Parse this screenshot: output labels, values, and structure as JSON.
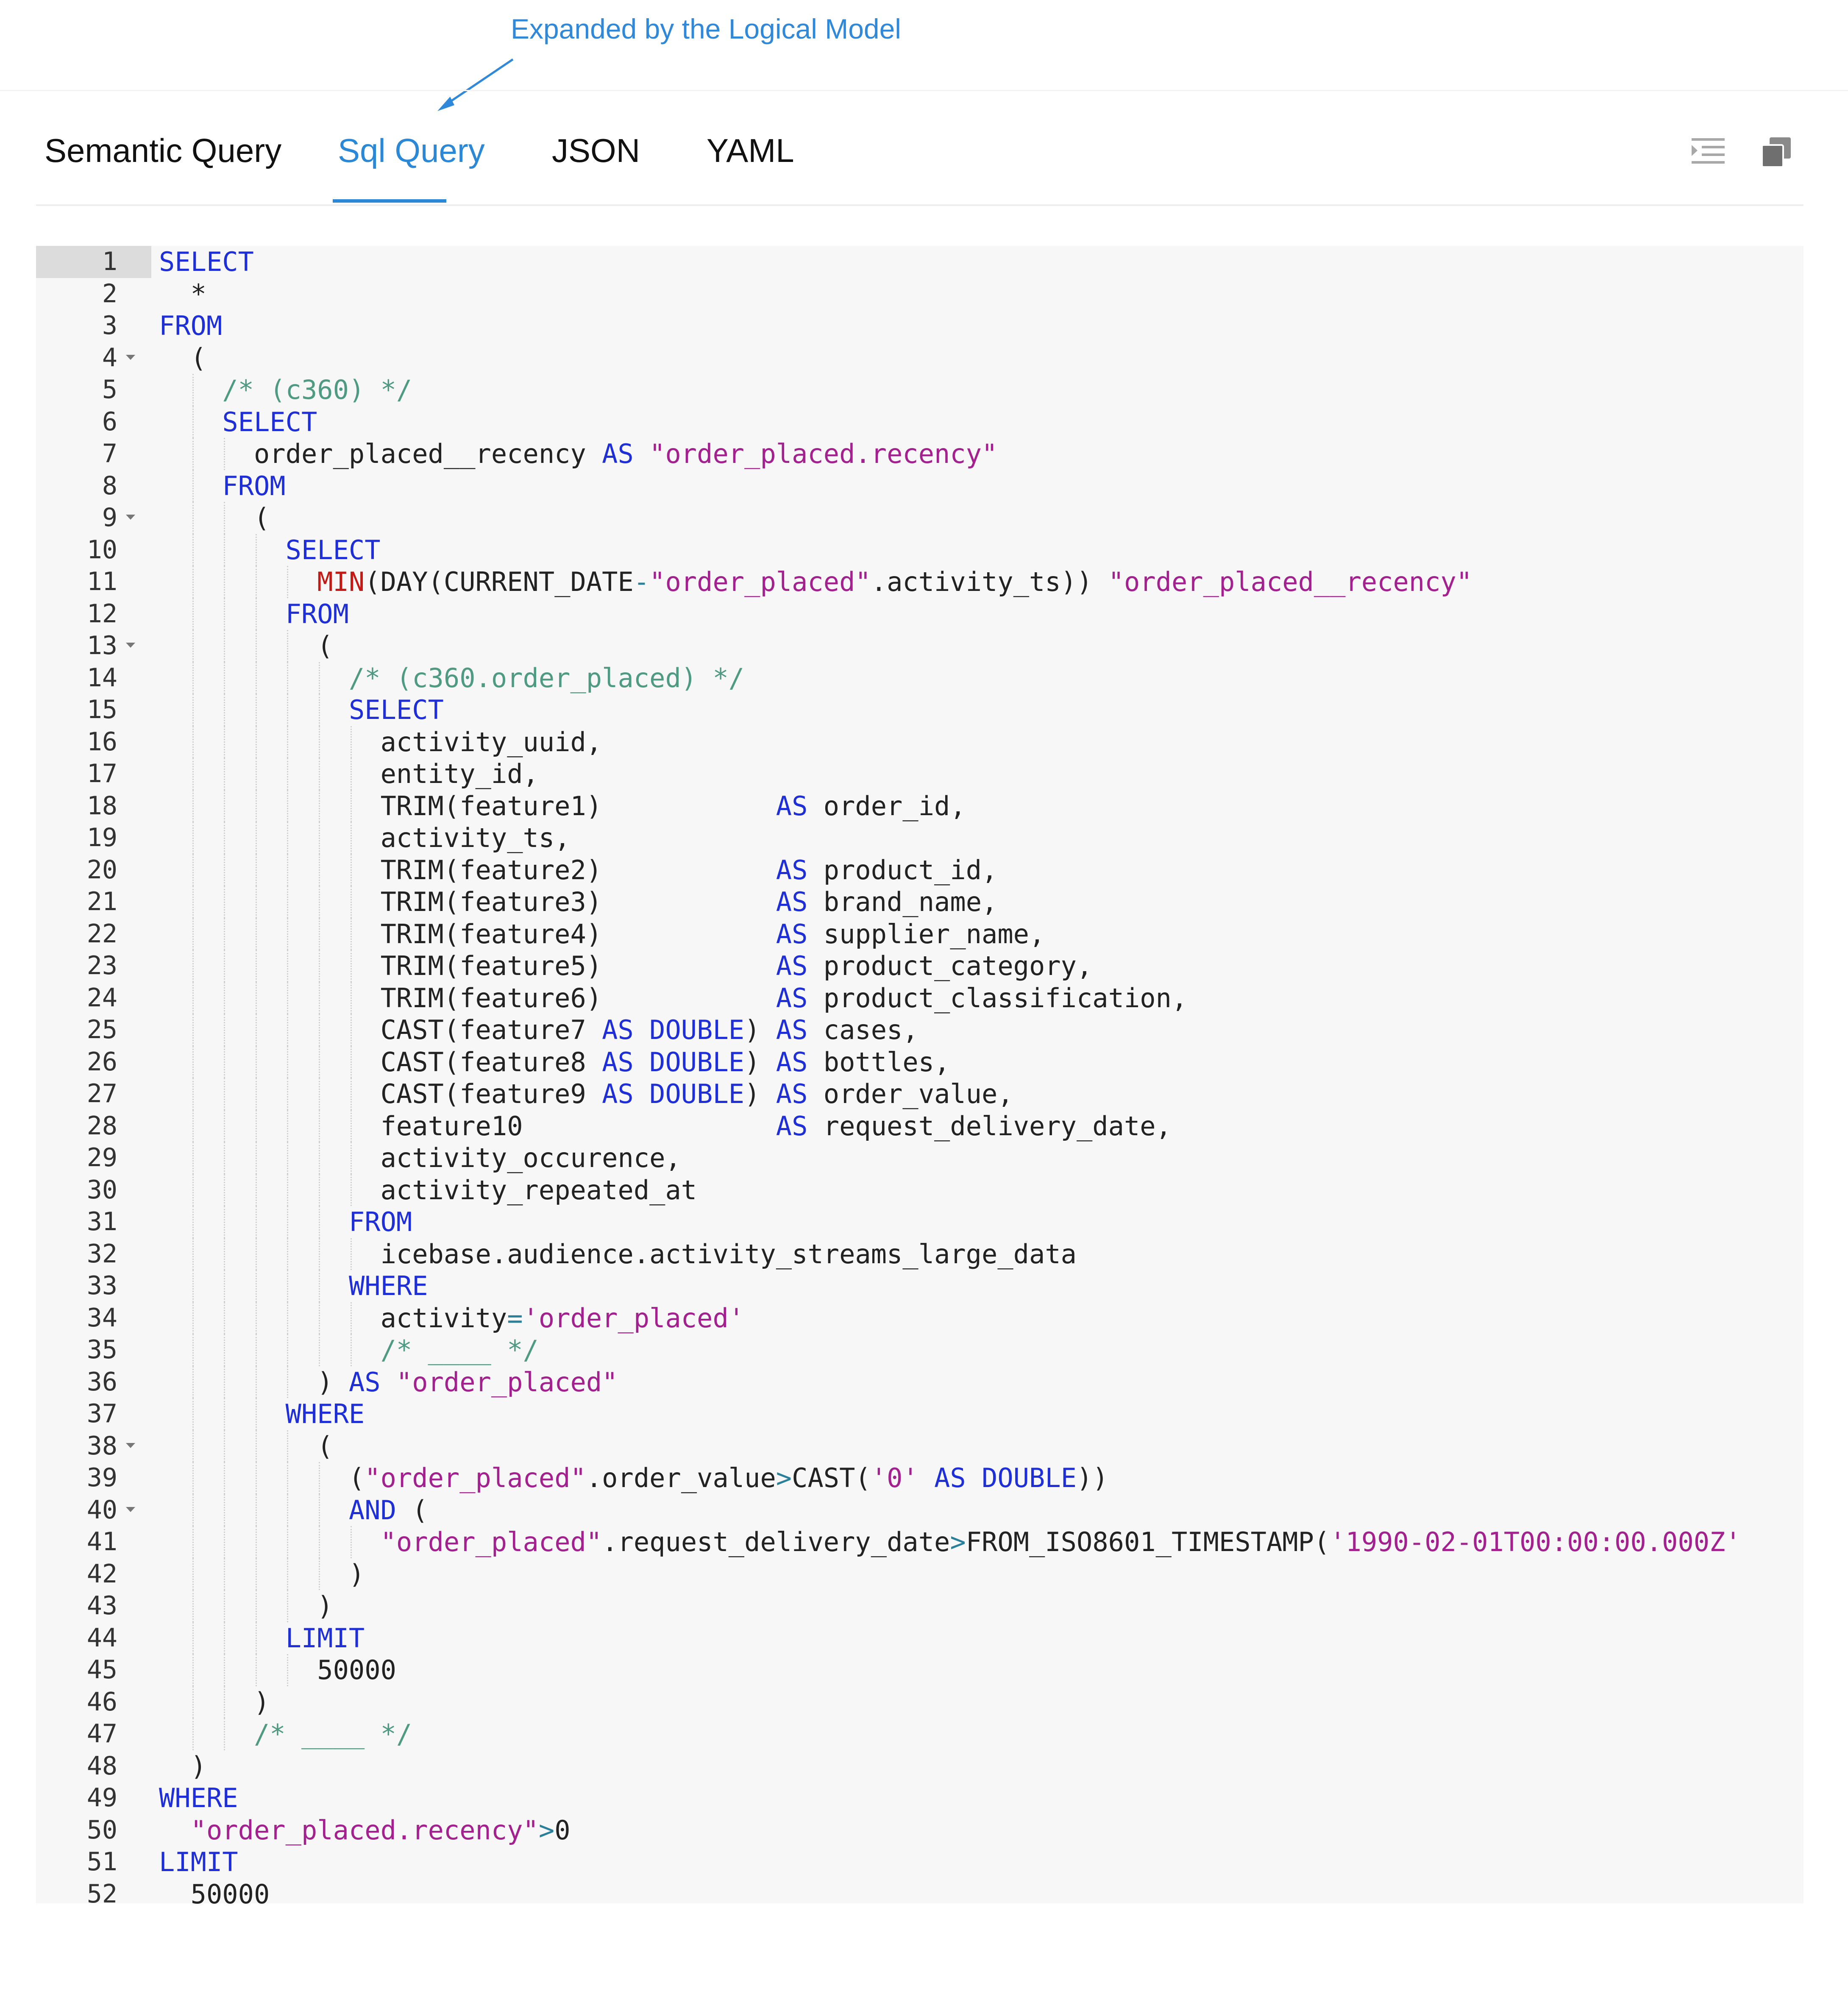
{
  "annotation": {
    "text": "Expanded by the Logical Model"
  },
  "tabs": [
    {
      "label": "Semantic Query",
      "active": false
    },
    {
      "label": "Sql Query",
      "active": true
    },
    {
      "label": "JSON",
      "active": false
    },
    {
      "label": "YAML",
      "active": false
    }
  ],
  "toolbar": {
    "format_icon": "format-indent-icon",
    "copy_icon": "copy-icon"
  },
  "colors": {
    "accent": "#2a88d6",
    "keyword": "#1f2fd8",
    "function": "#c41a16",
    "string": "#a3208f",
    "comment": "#4f9a83"
  },
  "editor": {
    "active_line": 1,
    "fold_lines": [
      4,
      9,
      13,
      38,
      40
    ],
    "lines": [
      "SELECT",
      "  *",
      "FROM",
      "  (",
      "    /* (c360) */",
      "    SELECT",
      "      order_placed__recency AS \"order_placed.recency\"",
      "    FROM",
      "      (",
      "        SELECT",
      "          MIN(DAY(CURRENT_DATE-\"order_placed\".activity_ts)) \"order_placed__recency\"",
      "        FROM",
      "          (",
      "            /* (c360.order_placed) */",
      "            SELECT",
      "              activity_uuid,",
      "              entity_id,",
      "              TRIM(feature1)           AS order_id,",
      "              activity_ts,",
      "              TRIM(feature2)           AS product_id,",
      "              TRIM(feature3)           AS brand_name,",
      "              TRIM(feature4)           AS supplier_name,",
      "              TRIM(feature5)           AS product_category,",
      "              TRIM(feature6)           AS product_classification,",
      "              CAST(feature7 AS DOUBLE) AS cases,",
      "              CAST(feature8 AS DOUBLE) AS bottles,",
      "              CAST(feature9 AS DOUBLE) AS order_value,",
      "              feature10                AS request_delivery_date,",
      "              activity_occurence,",
      "              activity_repeated_at",
      "            FROM",
      "              icebase.audience.activity_streams_large_data",
      "            WHERE",
      "              activity='order_placed'",
      "              /* ____ */",
      "          ) AS \"order_placed\"",
      "        WHERE",
      "          (",
      "            (\"order_placed\".order_value>CAST('0' AS DOUBLE))",
      "            AND (",
      "              \"order_placed\".request_delivery_date>FROM_ISO8601_TIMESTAMP('1990-02-01T00:00:00.000Z'",
      "            )",
      "          )",
      "        LIMIT",
      "          50000",
      "      )",
      "      /* ____ */",
      "  )",
      "WHERE",
      "  \"order_placed.recency\">0",
      "LIMIT",
      "  50000"
    ]
  }
}
